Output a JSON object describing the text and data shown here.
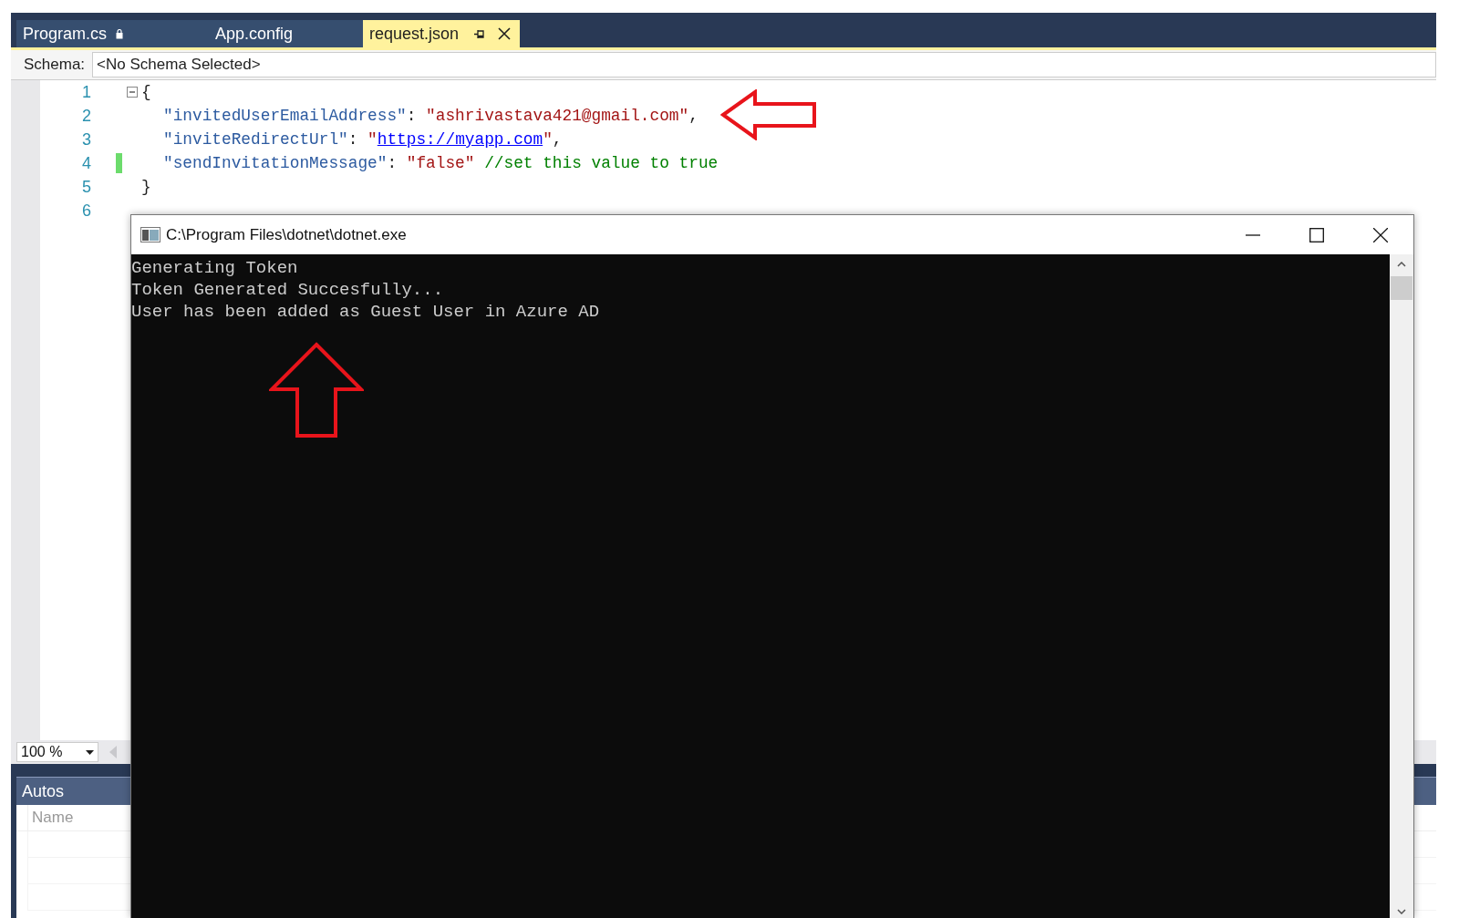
{
  "tabs": [
    {
      "label": "Program.cs",
      "selected": false,
      "locked": true
    },
    {
      "label": "App.config",
      "selected": false,
      "locked": false
    },
    {
      "label": "request.json",
      "selected": true,
      "locked": false
    }
  ],
  "schema": {
    "label": "Schema:",
    "value": "<No Schema Selected>"
  },
  "editor": {
    "lines": [
      {
        "number": "1",
        "modified": false,
        "expanded": true,
        "tokens": [
          {
            "kind": "punct",
            "text": "{"
          }
        ],
        "children": [
          {
            "number": "2",
            "modified": false,
            "tokens": [
              {
                "kind": "key",
                "text": "\"invitedUserEmailAddress\""
              },
              {
                "kind": "punct",
                "text": ": "
              },
              {
                "kind": "string",
                "text": "\"ashrivastava421@gmail.com\""
              },
              {
                "kind": "punct",
                "text": ","
              }
            ]
          },
          {
            "number": "3",
            "modified": false,
            "tokens": [
              {
                "kind": "key",
                "text": "\"inviteRedirectUrl\""
              },
              {
                "kind": "punct",
                "text": ": "
              },
              {
                "kind": "string",
                "text": "\""
              },
              {
                "kind": "link",
                "text": "https://myapp.com"
              },
              {
                "kind": "string",
                "text": "\""
              },
              {
                "kind": "punct",
                "text": ","
              }
            ]
          },
          {
            "number": "4",
            "modified": true,
            "tokens": [
              {
                "kind": "key",
                "text": "\"sendInvitationMessage\""
              },
              {
                "kind": "punct",
                "text": ": "
              },
              {
                "kind": "string",
                "text": "\"false\""
              },
              {
                "kind": "comment",
                "text": "//set this value to true"
              }
            ]
          }
        ]
      },
      {
        "number": "5",
        "modified": false,
        "tokens": [
          {
            "kind": "punct",
            "text": "}"
          }
        ]
      },
      {
        "number": "6",
        "modified": false
      }
    ],
    "zoom": "100 %"
  },
  "autos": {
    "title": "Autos",
    "columns": [
      "Name"
    ]
  },
  "console": {
    "title": "C:\\Program Files\\dotnet\\dotnet.exe",
    "lines": [
      "Generating Token",
      "Token Generated Succesfully...",
      "User has been added as Guest User in Azure AD"
    ]
  }
}
